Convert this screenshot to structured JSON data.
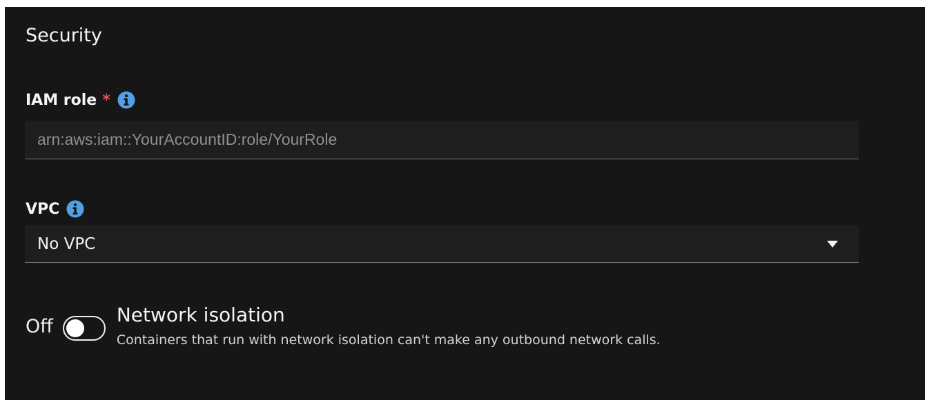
{
  "section": {
    "title": "Security"
  },
  "iam_role": {
    "label": "IAM role",
    "required_mark": "*",
    "placeholder": "arn:aws:iam::YourAccountID:role/YourRole",
    "value": "",
    "info_icon": "info-icon"
  },
  "vpc": {
    "label": "VPC",
    "selected": "No VPC",
    "info_icon": "info-icon"
  },
  "network_isolation": {
    "state_label": "Off",
    "enabled": false,
    "title": "Network isolation",
    "description": "Containers that run with network isolation can't make any outbound network calls."
  },
  "colors": {
    "background": "#161616",
    "input_background": "#1e1e1e",
    "info_accent": "#539fe5",
    "required": "#e0584f",
    "text": "#f5f5f5",
    "placeholder": "#8f8f8f"
  }
}
